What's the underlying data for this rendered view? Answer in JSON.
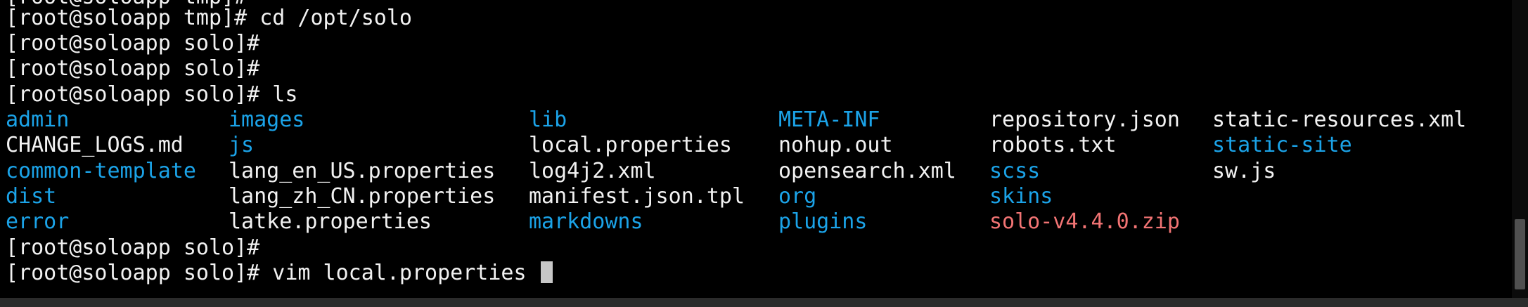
{
  "terminal": {
    "lines": {
      "partial_top": "[root@soloapp tmp]#",
      "cd_cmd": "[root@soloapp tmp]# cd /opt/solo",
      "prompt1": "[root@soloapp solo]#",
      "prompt2": "[root@soloapp solo]#",
      "ls_cmd": "[root@soloapp solo]# ls",
      "prompt3": "[root@soloapp solo]#",
      "vim_cmd": "[root@soloapp solo]# vim local.properties "
    },
    "ls_output": {
      "col1": [
        {
          "name": "admin",
          "kind": "dir"
        },
        {
          "name": "CHANGE_LOGS.md",
          "kind": "file"
        },
        {
          "name": "common-template",
          "kind": "dir"
        },
        {
          "name": "dist",
          "kind": "dir"
        },
        {
          "name": "error",
          "kind": "dir"
        }
      ],
      "col2": [
        {
          "name": "images",
          "kind": "dir"
        },
        {
          "name": "js",
          "kind": "dir"
        },
        {
          "name": "lang_en_US.properties",
          "kind": "file"
        },
        {
          "name": "lang_zh_CN.properties",
          "kind": "file"
        },
        {
          "name": "latke.properties",
          "kind": "file"
        }
      ],
      "col3": [
        {
          "name": "lib",
          "kind": "dir"
        },
        {
          "name": "local.properties",
          "kind": "file"
        },
        {
          "name": "log4j2.xml",
          "kind": "file"
        },
        {
          "name": "manifest.json.tpl",
          "kind": "file"
        },
        {
          "name": "markdowns",
          "kind": "dir"
        }
      ],
      "col4": [
        {
          "name": "META-INF",
          "kind": "dir"
        },
        {
          "name": "nohup.out",
          "kind": "file"
        },
        {
          "name": "opensearch.xml",
          "kind": "file"
        },
        {
          "name": "org",
          "kind": "dir"
        },
        {
          "name": "plugins",
          "kind": "dir"
        }
      ],
      "col5": [
        {
          "name": "repository.json",
          "kind": "file"
        },
        {
          "name": "robots.txt",
          "kind": "file"
        },
        {
          "name": "scss",
          "kind": "dir"
        },
        {
          "name": "skins",
          "kind": "dir"
        },
        {
          "name": "solo-v4.4.0.zip",
          "kind": "zip"
        }
      ],
      "col6": [
        {
          "name": "static-resources.xml",
          "kind": "file"
        },
        {
          "name": "static-site",
          "kind": "dir"
        },
        {
          "name": "sw.js",
          "kind": "file"
        }
      ]
    }
  },
  "colors": {
    "background": "#000000",
    "text": "#f2f2f2",
    "directory": "#1ba3e8",
    "archive": "#f27474",
    "cursor": "#c7c7c7"
  }
}
